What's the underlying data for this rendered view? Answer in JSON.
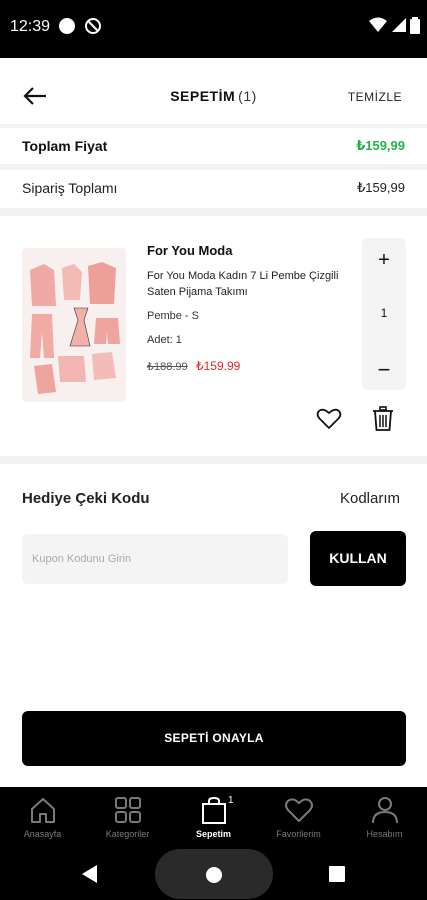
{
  "status_bar": {
    "time": "12:39"
  },
  "header": {
    "title": "SEPETİM",
    "count": "(1)",
    "clear_label": "TEMİZLE"
  },
  "summary": {
    "total_label": "Toplam Fiyat",
    "total_value": "₺159,99",
    "order_label": "Sipariş Toplamı",
    "order_value": "₺159,99"
  },
  "cart_item": {
    "brand": "For You Moda",
    "name": "For You Moda Kadın 7 Li Pembe Çizgili Saten Pijama Takımı",
    "variant": "Pembe - S",
    "quantity_text": "Adet: 1",
    "old_price": "₺188.99",
    "new_price": "₺159.99",
    "stepper_plus": "+",
    "stepper_value": "1",
    "stepper_minus": "−"
  },
  "coupon": {
    "title": "Hediye Çeki Kodu",
    "codes_link": "Kodlarım",
    "placeholder": "Kupon Kodunu Girin",
    "apply_label": "KULLAN"
  },
  "confirm_label": "SEPETİ ONAYLA",
  "bottom_nav": {
    "items": [
      {
        "label": "Anasayfa",
        "icon": "home-icon"
      },
      {
        "label": "Kategoriler",
        "icon": "grid-icon"
      },
      {
        "label": "Sepetim",
        "icon": "bag-icon",
        "badge": "1"
      },
      {
        "label": "Favorilerim",
        "icon": "heart-icon"
      },
      {
        "label": "Hesabım",
        "icon": "user-icon"
      }
    ]
  },
  "colors": {
    "accent_green": "#21b24b",
    "price_red": "#e3262d",
    "dark": "#000000"
  }
}
